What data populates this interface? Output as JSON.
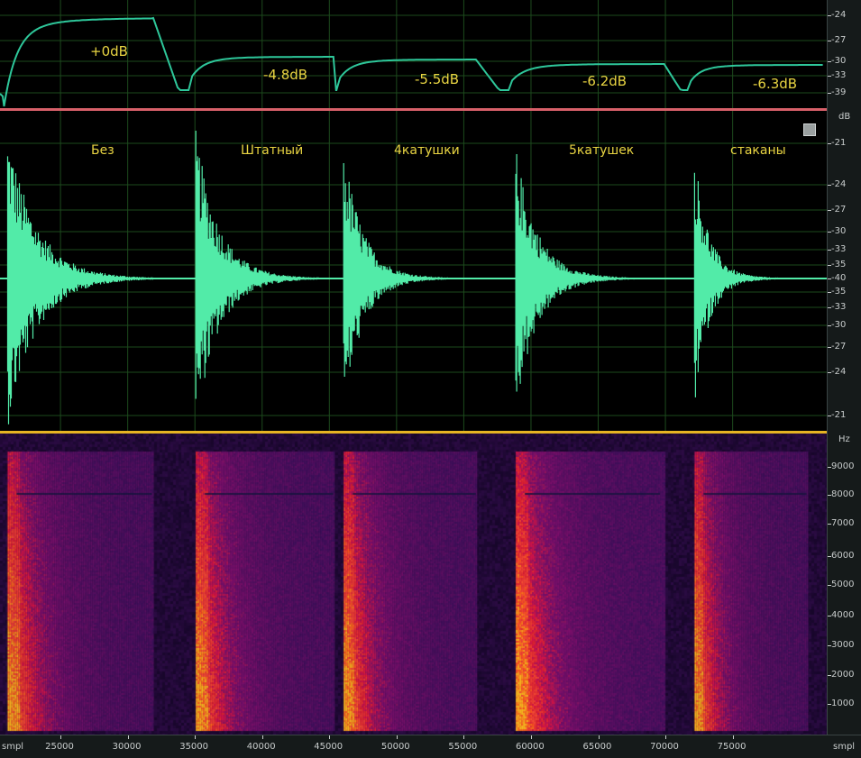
{
  "colors": {
    "envelope": "#2ec79a",
    "waveform": "#52eba8",
    "grid": "#1d4a1d",
    "label_yellow": "#e8d442",
    "separator_top": "#d8606a",
    "separator_mid": "#e6b422",
    "ruler_bg": "#151a1a",
    "ruler_text": "#c8cccc"
  },
  "envelope_panel": {
    "labels": [
      "+0dB",
      "-4.8dB",
      "-5.5dB",
      "-6.2dB",
      "-6.3dB"
    ],
    "ruler_ticks": [
      "-24",
      "-27",
      "-30",
      "-33",
      "-39"
    ]
  },
  "waveform_panel": {
    "labels": [
      "Без",
      "Штатный",
      "4катушки",
      "5катушек",
      "стаканы"
    ],
    "ruler_unit": "dB",
    "ruler_ticks": [
      "-21",
      "-24",
      "-27",
      "-30",
      "-33",
      "-35",
      "-40",
      "-35",
      "-33",
      "-30",
      "-27",
      "-24",
      "-21"
    ],
    "segments": [
      {
        "name": "Без",
        "start": 20800,
        "end": 31900,
        "amp": 0.98,
        "decay": 0.19
      },
      {
        "name": "Штатный",
        "start": 34800,
        "end": 45300,
        "amp": 0.97,
        "decay": 0.16
      },
      {
        "name": "4катушки",
        "start": 45800,
        "end": 55900,
        "amp": 0.87,
        "decay": 0.14
      },
      {
        "name": "5катушек",
        "start": 58600,
        "end": 69900,
        "amp": 0.86,
        "decay": 0.14
      },
      {
        "name": "стаканы",
        "start": 71900,
        "end": 80500,
        "amp": 0.85,
        "decay": 0.12
      }
    ]
  },
  "spectrogram_panel": {
    "ruler_unit": "Hz",
    "ruler_ticks": [
      "9000",
      "8000",
      "7000",
      "6000",
      "5000",
      "4000",
      "3000",
      "2000",
      "1000"
    ]
  },
  "time_ruler": {
    "unit": "smpl",
    "ticks": [
      "25000",
      "30000",
      "35000",
      "40000",
      "45000",
      "50000",
      "55000",
      "60000",
      "65000",
      "70000",
      "75000"
    ],
    "range": [
      20500,
      82000
    ]
  }
}
